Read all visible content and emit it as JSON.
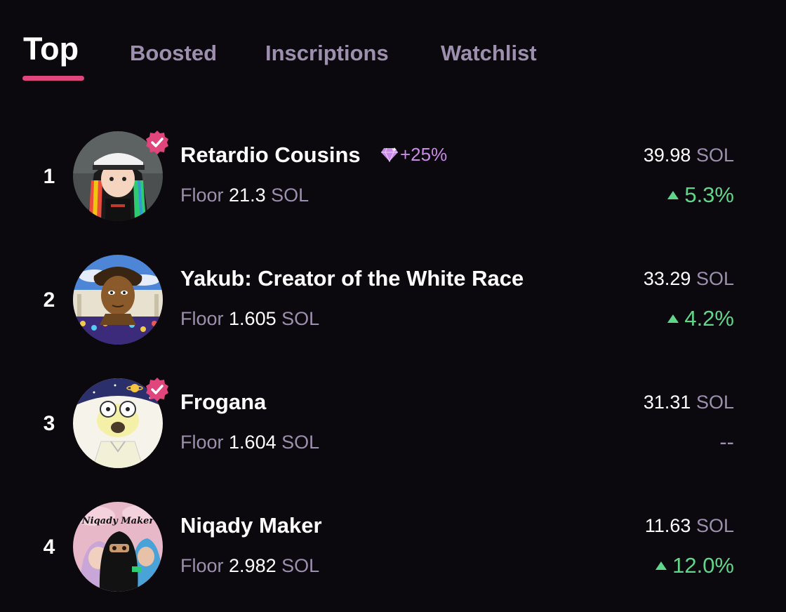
{
  "tabs": [
    {
      "label": "Top",
      "active": true
    },
    {
      "label": "Boosted",
      "active": false
    },
    {
      "label": "Inscriptions",
      "active": false
    },
    {
      "label": "Watchlist",
      "active": false
    }
  ],
  "colors": {
    "background": "#0b080e",
    "accent": "#e0457b",
    "muted": "#9d8fae",
    "positive": "#5fd68a",
    "boost": "#c98ae8"
  },
  "collections": [
    {
      "rank": "1",
      "name": "Retardio Cousins",
      "verified": true,
      "boost": "+25%",
      "boost_icon": "gem-icon",
      "floor_label": "Floor",
      "floor_value": "21.3",
      "floor_unit": "SOL",
      "volume_value": "39.98",
      "volume_unit": "SOL",
      "change": "5.3%",
      "change_direction": "up"
    },
    {
      "rank": "2",
      "name": "Yakub: Creator of the White Race",
      "verified": false,
      "floor_label": "Floor",
      "floor_value": "1.605",
      "floor_unit": "SOL",
      "volume_value": "33.29",
      "volume_unit": "SOL",
      "change": "4.2%",
      "change_direction": "up"
    },
    {
      "rank": "3",
      "name": "Frogana",
      "verified": true,
      "floor_label": "Floor",
      "floor_value": "1.604",
      "floor_unit": "SOL",
      "volume_value": "31.31",
      "volume_unit": "SOL",
      "change": "--",
      "change_direction": "none"
    },
    {
      "rank": "4",
      "name": "Niqady Maker",
      "verified": false,
      "avatar_text": "Niqady Maker",
      "floor_label": "Floor",
      "floor_value": "2.982",
      "floor_unit": "SOL",
      "volume_value": "11.63",
      "volume_unit": "SOL",
      "change": "12.0%",
      "change_direction": "up"
    }
  ]
}
